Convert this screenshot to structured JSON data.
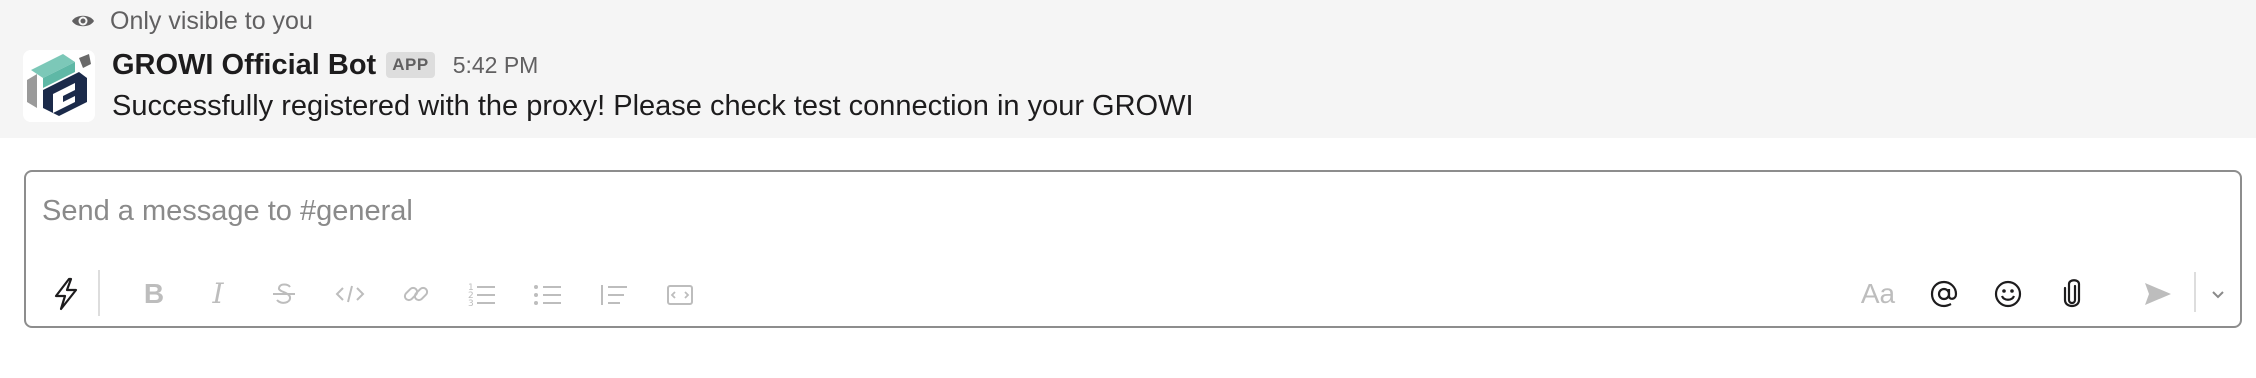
{
  "ephemeral_notice": {
    "text": "Only visible to you",
    "icon": "eye-icon"
  },
  "message": {
    "sender": "GROWI Official Bot",
    "badge": "APP",
    "time": "5:42 PM",
    "text": "Successfully registered with the proxy! Please check test connection in your GROWI",
    "avatar_icon": "growi-logo-icon"
  },
  "composer": {
    "placeholder": "Send a message to #general",
    "value": "",
    "toolbar_left": [
      {
        "name": "shortcuts",
        "icon": "lightning-icon"
      },
      {
        "name": "bold",
        "icon": "bold-icon",
        "glyph": "B"
      },
      {
        "name": "italic",
        "icon": "italic-icon",
        "glyph": "I"
      },
      {
        "name": "strikethrough",
        "icon": "strikethrough-icon"
      },
      {
        "name": "code",
        "icon": "code-icon"
      },
      {
        "name": "link",
        "icon": "link-icon"
      },
      {
        "name": "ordered-list",
        "icon": "ordered-list-icon"
      },
      {
        "name": "bulleted-list",
        "icon": "bulleted-list-icon"
      },
      {
        "name": "blockquote",
        "icon": "blockquote-icon"
      },
      {
        "name": "code-block",
        "icon": "code-block-icon"
      }
    ],
    "toolbar_right": [
      {
        "name": "formatting",
        "icon": "formatting-icon",
        "glyph": "Aa"
      },
      {
        "name": "mention",
        "icon": "at-mention-icon"
      },
      {
        "name": "emoji",
        "icon": "emoji-icon"
      },
      {
        "name": "attach",
        "icon": "paperclip-icon"
      },
      {
        "name": "send",
        "icon": "send-icon"
      },
      {
        "name": "send-options",
        "icon": "chevron-down-icon"
      }
    ]
  },
  "colors": {
    "message_bg": "#f5f5f5",
    "text": "#1d1c1d",
    "muted": "#616061",
    "disabled_icon": "#bdbdbd",
    "active_icon": "#1d1c1d",
    "composer_border": "#8d8d8d",
    "avatar_teal": "#5fb8a6",
    "avatar_navy": "#1b2a4a"
  }
}
